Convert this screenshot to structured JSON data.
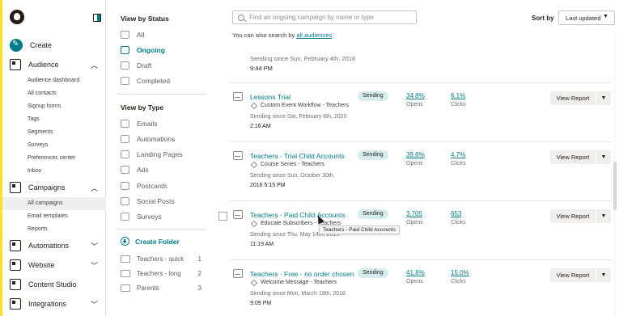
{
  "colors": {
    "accent": "#007c89",
    "brand_yellow": "#ffe01b",
    "badge_bg": "#d6edf0"
  },
  "sidebar": {
    "create_label": "Create",
    "sections": [
      {
        "label": "Audience",
        "icon": "audience-icon",
        "expanded": true
      },
      {
        "label": "Campaigns",
        "icon": "campaigns-icon",
        "expanded": true
      },
      {
        "label": "Automations",
        "icon": "automations-icon",
        "expanded": false
      },
      {
        "label": "Website",
        "icon": "website-icon",
        "expanded": false
      },
      {
        "label": "Content Studio",
        "icon": "content-studio-icon",
        "expanded": false
      },
      {
        "label": "Integrations",
        "icon": "integrations-icon",
        "expanded": false
      }
    ],
    "audience_items": [
      "Audience dashboard",
      "All contacts",
      "Signup forms",
      "Tags",
      "Segments",
      "Surveys",
      "Preferences center",
      "Inbox"
    ],
    "campaign_items": [
      "All campaigns",
      "Email templates",
      "Reports"
    ],
    "active_item": "All campaigns"
  },
  "filters": {
    "status_heading": "View by Status",
    "status_items": [
      "All",
      "Ongoing",
      "Draft",
      "Completed"
    ],
    "active_status": "Ongoing",
    "type_heading": "View by Type",
    "type_items": [
      "Emails",
      "Automations",
      "Landing Pages",
      "Ads",
      "Postcards",
      "Social Posts",
      "Surveys"
    ],
    "create_folder": "Create Folder",
    "folders": [
      {
        "name": "Teachers - quick",
        "count": "1"
      },
      {
        "name": "Teachers - long",
        "count": "2"
      },
      {
        "name": "Parents",
        "count": "3"
      }
    ]
  },
  "search": {
    "placeholder": "Find an ongoing campaign by name or type",
    "hint_prefix": "You can also search by",
    "hint_link": "all audiences",
    "hint_suffix": "."
  },
  "sort": {
    "label": "Sort by",
    "value": "Last updated"
  },
  "partial_row": {
    "since": "Sending since Sun, February 4th, 2018",
    "time": "9:44 PM"
  },
  "campaigns": [
    {
      "name": "Lessons Trial",
      "type": "Custom Event Workflow - Teachers",
      "since": "Sending since Sat, February 8th, 2020",
      "time": "2:16 AM",
      "status": "Sending",
      "opens": "34.8%",
      "opens_label": "Opens",
      "clicks": "6.1%",
      "clicks_label": "Clicks",
      "button": "View Report"
    },
    {
      "name": "Teachers - Trial Child Accounts",
      "type": "Course Series - Teachers",
      "since": "Sending since Sun, October 30th,",
      "time": "2016 5:15 PM",
      "status": "Sending",
      "opens": "39.6%",
      "opens_label": "Opens",
      "clicks": "4.7%",
      "clicks_label": "Clicks",
      "button": "View Report"
    },
    {
      "name": "Teachers - Paid Child Accounts",
      "type": "Educate Subscribers - Teachers",
      "since": "Sending since Thu, May 14th, 2015",
      "time": "11:19 AM",
      "status": "Sending",
      "opens": "3,705",
      "opens_label": "Opens",
      "clicks": "653",
      "clicks_label": "Clicks",
      "button": "View Report"
    },
    {
      "name": "Teachers - Free - no order chosen",
      "type": "Welcome Message - Teachers",
      "since": "Sending since Mon, March 19th, 2018",
      "time": "9:09 PM",
      "status": "Sending",
      "opens": "41.8%",
      "opens_label": "Opens",
      "clicks": "15.0%",
      "clicks_label": "Clicks",
      "button": "View Report"
    }
  ],
  "tooltip": "Teachers - Paid Child Accounts"
}
